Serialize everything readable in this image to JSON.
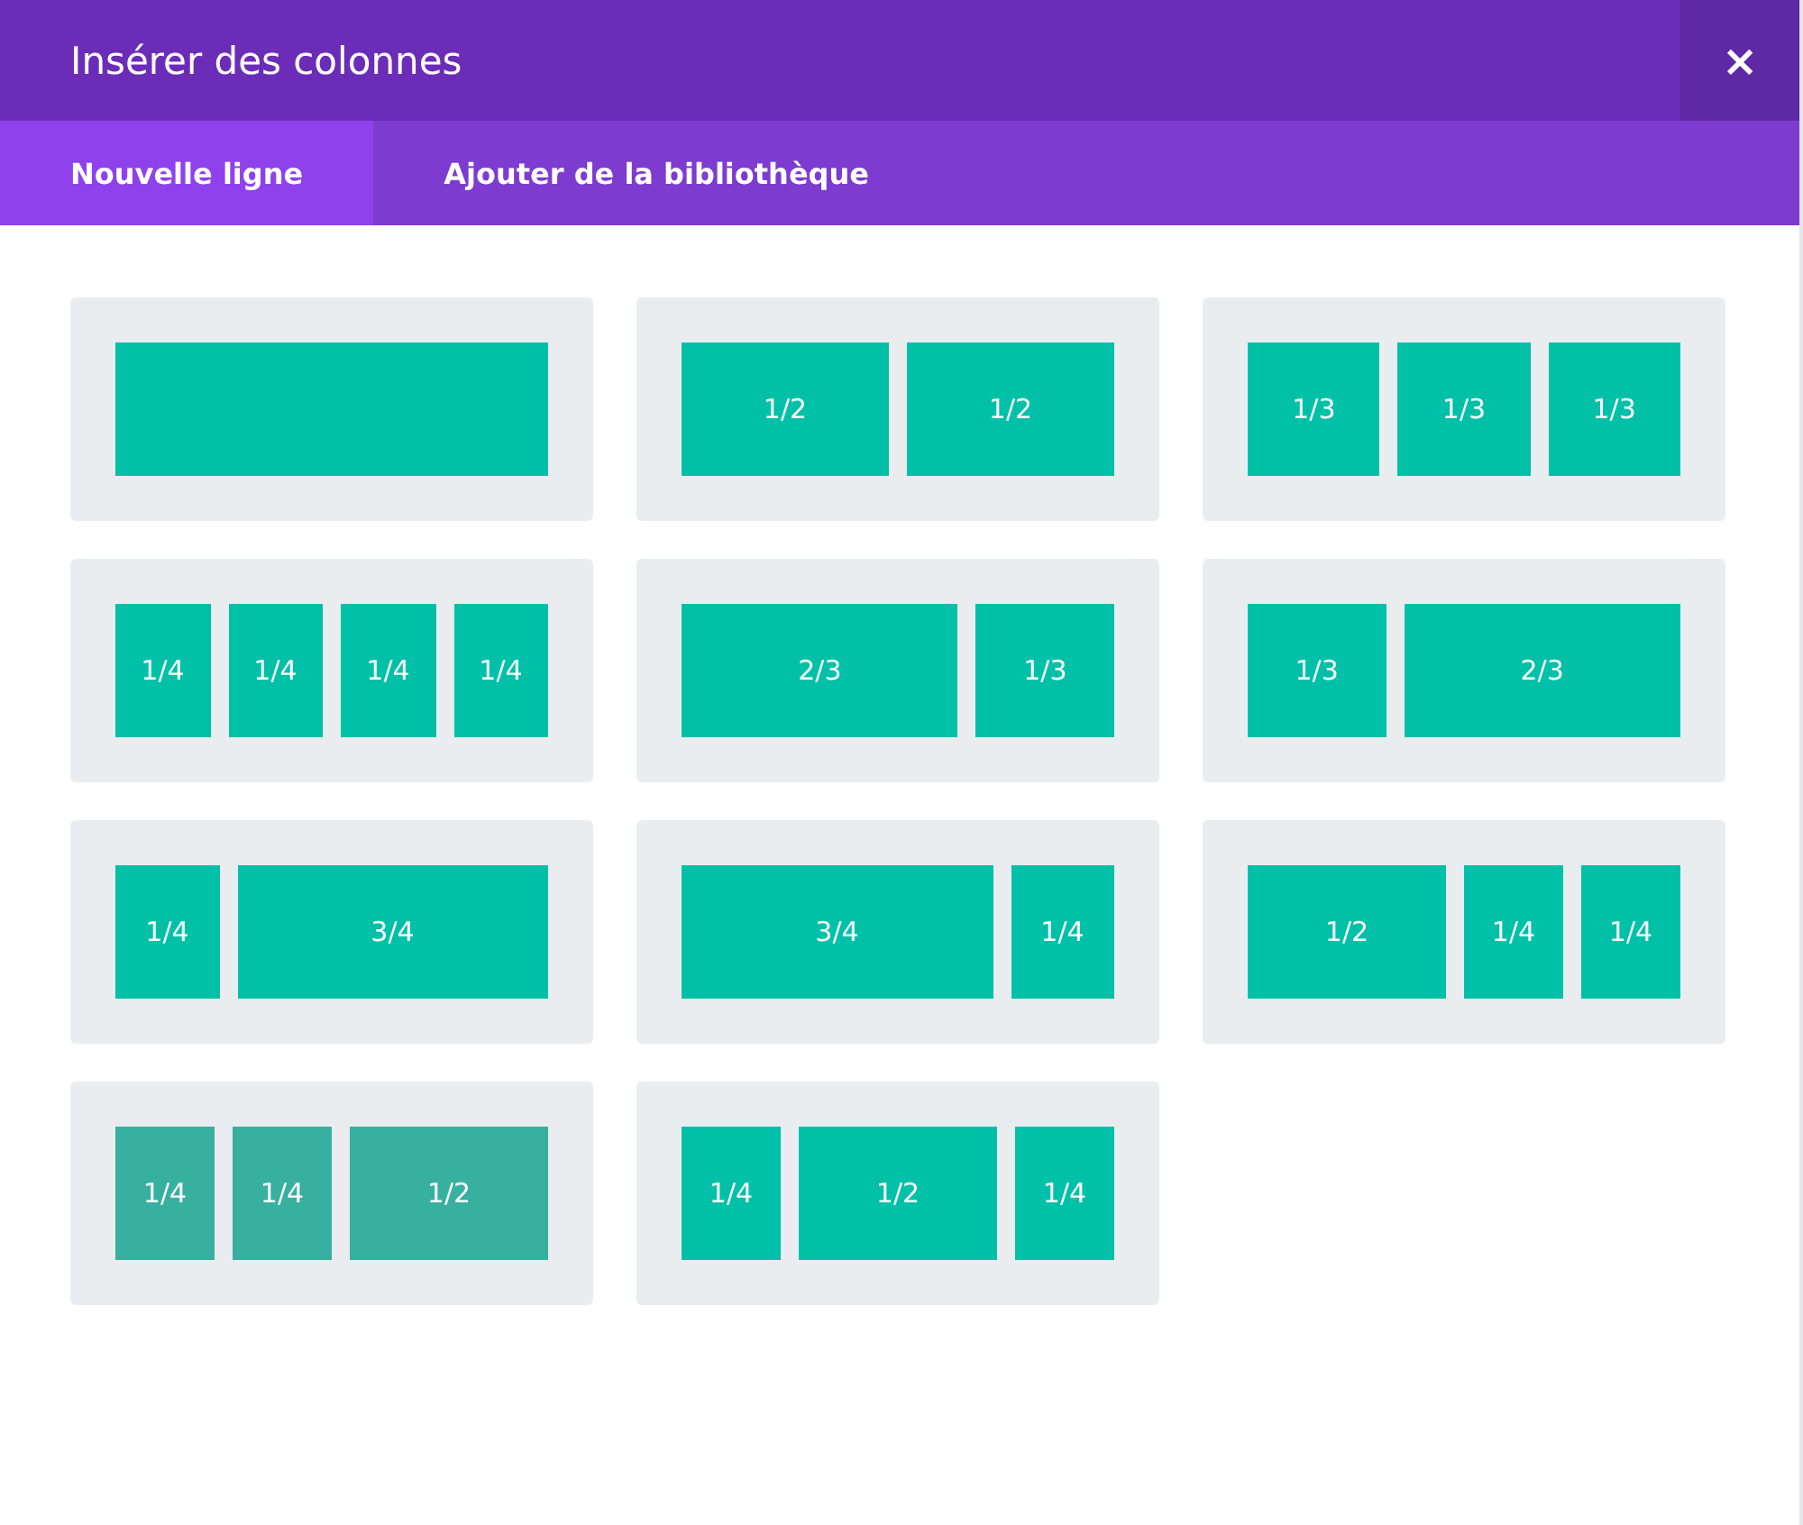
{
  "window": {
    "title": "Insérer des colonnes",
    "close": "×"
  },
  "tabs": [
    {
      "label": "Nouvelle ligne",
      "selected": true
    },
    {
      "label": "Ajouter de la bibliothèque",
      "selected": false
    }
  ],
  "layouts": [
    {
      "hovered": false,
      "columns": [
        ""
      ]
    },
    {
      "hovered": false,
      "columns": [
        "1/2",
        "1/2"
      ]
    },
    {
      "hovered": false,
      "columns": [
        "1/3",
        "1/3",
        "1/3"
      ]
    },
    {
      "hovered": false,
      "columns": [
        "1/4",
        "1/4",
        "1/4",
        "1/4"
      ]
    },
    {
      "hovered": false,
      "columns": [
        "2/3",
        "1/3"
      ]
    },
    {
      "hovered": false,
      "columns": [
        "1/3",
        "2/3"
      ]
    },
    {
      "hovered": false,
      "columns": [
        "1/4",
        "3/4"
      ]
    },
    {
      "hovered": false,
      "columns": [
        "3/4",
        "1/4"
      ]
    },
    {
      "hovered": false,
      "columns": [
        "1/2",
        "1/4",
        "1/4"
      ]
    },
    {
      "hovered": true,
      "columns": [
        "1/4",
        "1/4",
        "1/2"
      ]
    },
    {
      "hovered": false,
      "columns": [
        "1/4",
        "1/2",
        "1/4"
      ]
    }
  ]
}
